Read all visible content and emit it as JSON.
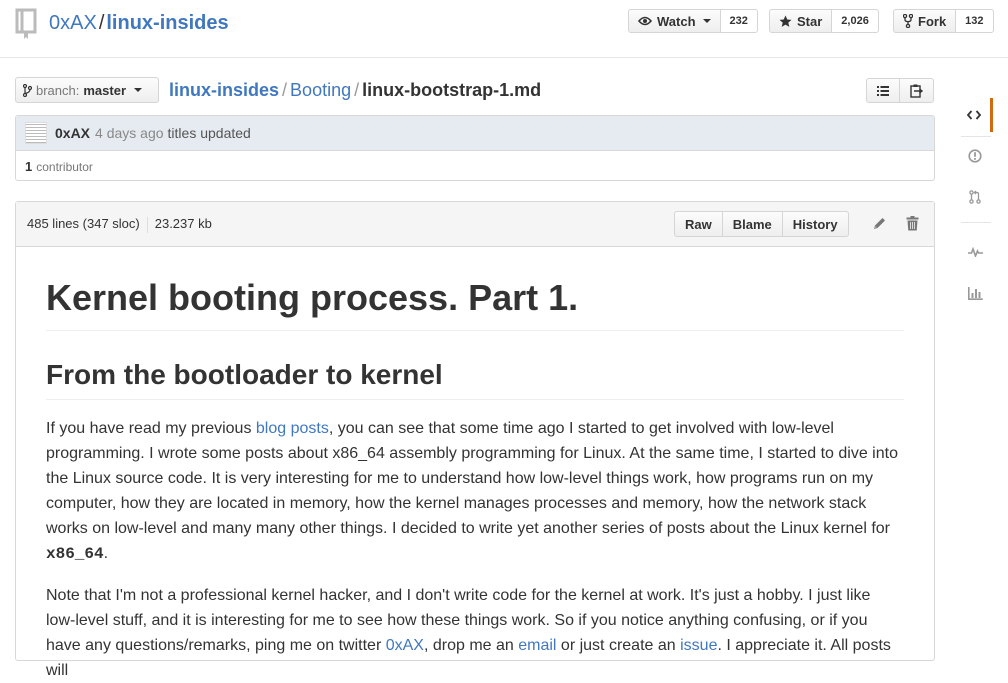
{
  "header": {
    "owner": "0xAX",
    "separator": "/",
    "repo": "linux-insides",
    "watch": {
      "label": "Watch",
      "count": "232"
    },
    "star": {
      "label": "Star",
      "count": "2,026"
    },
    "fork": {
      "label": "Fork",
      "count": "132"
    }
  },
  "breadcrumb": {
    "branch_label": "branch:",
    "branch_value": "master",
    "repo": "linux-insides",
    "sep": "/",
    "dir": "Booting",
    "file": "linux-bootstrap-1.md"
  },
  "commit": {
    "author": "0xAX",
    "ago": "4 days ago",
    "message": "titles updated",
    "contributors_count": "1",
    "contributors_label": "contributor"
  },
  "file": {
    "lines": "485 lines (347 sloc)",
    "size": "23.237 kb",
    "raw_label": "Raw",
    "blame_label": "Blame",
    "history_label": "History"
  },
  "content": {
    "h1": "Kernel booting process. Part 1.",
    "h2": "From the bootloader to kernel",
    "p1_a": "If you have read my previous ",
    "p1_link": "blog posts",
    "p1_b": ", you can see that some time ago I started to get involved with low-level programming. I wrote some posts about x86_64 assembly programming for Linux. At the same time, I started to dive into the Linux source code. It is very interesting for me to understand how low-level things work, how programs run on my computer, how they are located in memory, how the kernel manages processes and memory, how the network stack works on low-level and many many other things. I decided to write yet another series of posts about the Linux kernel for ",
    "p1_code": "x86_64",
    "p1_end": ".",
    "p2_a": "Note that I'm not a professional kernel hacker, and I don't write code for the kernel at work. It's just a hobby. I just like low-level stuff, and it is interesting for me to see how these things work. So if you notice anything confusing, or if you have any questions/remarks, ping me on twitter ",
    "p2_link1": "0xAX",
    "p2_b": ", drop me an ",
    "p2_link2": "email",
    "p2_c": " or just create an ",
    "p2_link3": "issue",
    "p2_d": ". I appreciate it. All posts will"
  },
  "icons": {
    "repo": "repo-icon",
    "watch": "eye-icon",
    "star": "star-icon",
    "fork": "fork-icon",
    "branch": "branch-icon",
    "list": "list-icon",
    "clipboard": "clipboard-icon",
    "edit": "pencil-icon",
    "delete": "trash-icon",
    "code": "code-icon",
    "issues": "issue-icon",
    "pulls": "pull-request-icon",
    "pulse": "pulse-icon",
    "graphs": "graph-icon"
  },
  "colors": {
    "link": "#4078c0",
    "active_rail": "#d26911",
    "commit_bar": "#e6ebf1"
  }
}
